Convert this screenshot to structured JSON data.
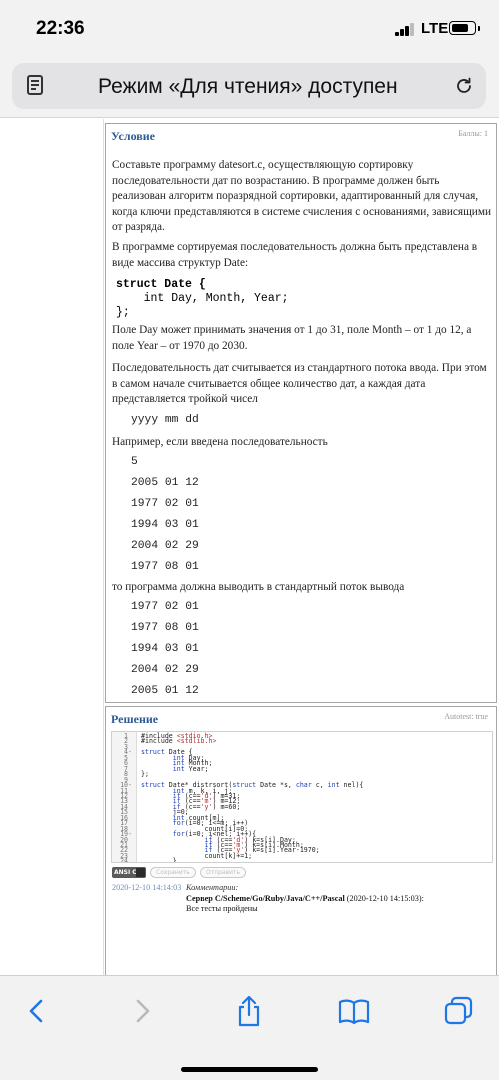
{
  "status_bar": {
    "time": "22:36",
    "network": "LTE",
    "signal_bars": 3,
    "battery_level": 0.6
  },
  "address_bar": {
    "text": "Режим «Для чтения» доступен"
  },
  "condition_panel": {
    "title": "Условие",
    "meta": "Баллы: 1",
    "paragraph_1": "Составьте программу datesort.c, осуществляющую сортировку последовательности дат по возрастанию. В программе должен быть реализован алгоритм поразрядной сортировки, адаптированный для случая, когда ключи представляются в системе счисления с основаниями, зависящими от разряда.",
    "paragraph_2": "В программе сортируемая последовательность должна быть представлена в виде массива структур Date:",
    "struct_line_1": "struct Date {",
    "struct_line_2": "    int Day, Month, Year;",
    "struct_line_3": "};",
    "paragraph_3": "Поле Day может принимать значения от 1 до 31, поле Month – от 1 до 12, а поле Year – от 1970 до 2030.",
    "paragraph_4": "Последовательность дат считывается из стандартного потока ввода. При этом в самом начале считывается общее количество дат, а каждая дата представляется тройкой чисел",
    "format": "yyyy mm dd",
    "paragraph_5": "Например, если введена последовательность",
    "input_example": [
      "5",
      "2005 01 12",
      "1977 02 01",
      "1994 03 01",
      "2004 02 29",
      "1977 08 01"
    ],
    "paragraph_6": "то программа должна выводить в стандартный поток вывода",
    "output_example": [
      "1977 02 01",
      "1977 08 01",
      "1994 03 01",
      "2004 02 29",
      "2005 01 12"
    ]
  },
  "solution_panel": {
    "title": "Решение",
    "meta": "Autotest: true",
    "code_lines": [
      "#include <stdio.h>",
      "#include <stdlib.h>",
      "",
      "struct Date {",
      "        int Day;",
      "        int Month;",
      "        int Year;",
      "};",
      "",
      "struct Date* distrsort(struct Date *s, char c, int nel){",
      "        int m, k, i, j;",
      "        if (c=='d') m=31;",
      "        if (c=='m') m=12;",
      "        if (c=='y') m=60;",
      "        j=0;",
      "        int count[m];",
      "        for(i=0; i<=m; i++)",
      "                count[i]=0;",
      "        for(i=0; i<nel; i++){",
      "                if (c=='d') k=s[i].Day;",
      "                if (c=='m') k=s[i].Month;",
      "                if (c=='y') k=s[i].Year-1970;",
      "                count[k]+=1;",
      "        }"
    ],
    "code_line_numbers": [
      "1",
      "2",
      "3",
      "4",
      "5",
      "6",
      "7",
      "8",
      "9",
      "10",
      "11",
      "12",
      "13",
      "14",
      "15",
      "16",
      "17",
      "18",
      "19",
      "20",
      "21",
      "22",
      "23",
      "24"
    ],
    "fold_markers": [
      "",
      "",
      "",
      "-",
      "",
      "",
      "",
      "",
      "",
      "-",
      "",
      "",
      "",
      "",
      "",
      "",
      "",
      "",
      "-",
      "",
      "",
      "",
      "",
      ""
    ],
    "language": "ANSI C",
    "button_save": "Сохранить",
    "button_submit": "Отправить",
    "submission": {
      "date": "2020-12-10 14:14:03",
      "comment_label": "Комментарии:",
      "server": "Сервер C/Scheme/Go/Ruby/Java/C++/Pascal",
      "server_time": "(2020-12-10 14:15:03):",
      "result": "Все тесты пройдены"
    }
  },
  "toolbar": {
    "icons": [
      "back-icon",
      "forward-icon",
      "share-icon",
      "bookmarks-icon",
      "tabs-icon"
    ]
  }
}
